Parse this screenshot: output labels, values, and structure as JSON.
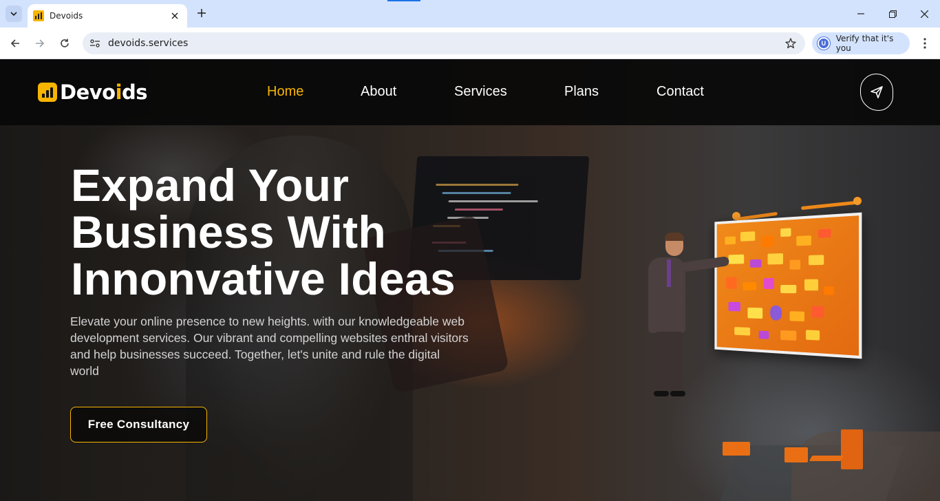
{
  "browser": {
    "tab_title": "Devoids",
    "url": "devoids.services",
    "profile_chip_label": "Verify that it's you",
    "profile_initial": "U",
    "icons": [
      "tab-search-icon",
      "close-icon",
      "plus-icon",
      "minimize-icon",
      "restore-icon",
      "close-window-icon",
      "back-icon",
      "forward-icon",
      "reload-icon",
      "site-info-icon",
      "star-icon",
      "more-icon"
    ]
  },
  "site": {
    "logo": {
      "part1": "Devo",
      "accent": "i",
      "part2": "ds"
    },
    "nav": [
      {
        "label": "Home",
        "active": true
      },
      {
        "label": "About",
        "active": false
      },
      {
        "label": "Services",
        "active": false
      },
      {
        "label": "Plans",
        "active": false
      },
      {
        "label": "Contact",
        "active": false
      }
    ],
    "send_icon": "paper-plane-icon",
    "accent_color": "#f7b500"
  },
  "hero": {
    "title_lines": [
      "Expand Your",
      "Business With",
      "Innonvative Ideas"
    ],
    "description": "Elevate your online presence to new heights. with our knowledgeable web development services. Our vibrant and compelling websites enthral visitors and help businesses succeed. Together, let's unite and rule the digital world",
    "cta_label": "Free Consultancy"
  }
}
